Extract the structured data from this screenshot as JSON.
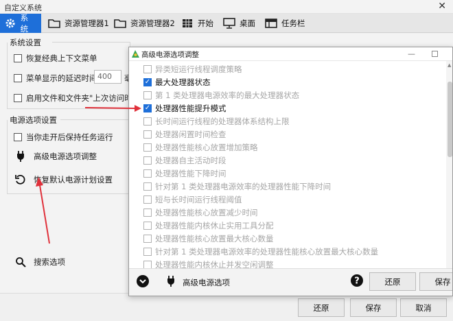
{
  "window": {
    "title": "自定义系统",
    "close_glyph": "✕"
  },
  "tabs": [
    {
      "label": "系统",
      "icon": "gear-icon",
      "active": true
    },
    {
      "label": "资源管理器1",
      "icon": "folder-icon"
    },
    {
      "label": "资源管理器2",
      "icon": "folder-icon"
    },
    {
      "label": "开始",
      "icon": "start-grid-icon"
    },
    {
      "label": "桌面",
      "icon": "monitor-icon"
    },
    {
      "label": "任务栏",
      "icon": "taskbar-icon"
    }
  ],
  "system_settings": {
    "title": "系统设置",
    "restore_classic_menu": "恢复经典上下文菜单",
    "menu_delay": {
      "label": "菜单显示的延迟时间",
      "value": "400",
      "unit": "毫"
    },
    "enable_recent_access": "启用文件和文件夹\"上次访问时间\""
  },
  "power_options": {
    "title": "电源选项设置",
    "keep_tasks": "当你走开后保持任务运行",
    "advanced_power": "高级电源选项调整",
    "restore_default_plan": "恢复默认电源计划设置"
  },
  "search": {
    "label": "搜索选项"
  },
  "footer": {
    "restore": "还原",
    "save": "保存",
    "cancel": "取消"
  },
  "dialog": {
    "title": "高级电源选项调整",
    "minimize_glyph": "—",
    "items": [
      {
        "label": "异类短运行线程调度策略",
        "checked": false
      },
      {
        "label": "最大处理器状态",
        "checked": true
      },
      {
        "label": "第 1 类处理器电源效率的最大处理器状态",
        "checked": false
      },
      {
        "label": "处理器性能提升模式",
        "checked": true
      },
      {
        "label": "长时间运行线程的处理器体系结构上限",
        "checked": false
      },
      {
        "label": "处理器闲置时间检查",
        "checked": false
      },
      {
        "label": "处理器性能核心放置增加策略",
        "checked": false
      },
      {
        "label": "处理器自主活动时段",
        "checked": false
      },
      {
        "label": "处理器性能下降时间",
        "checked": false
      },
      {
        "label": "针对第 1 类处理器电源效率的处理器性能下降时间",
        "checked": false
      },
      {
        "label": "短与长时间运行线程阈值",
        "checked": false
      },
      {
        "label": "处理器性能核心放置减少时间",
        "checked": false
      },
      {
        "label": "处理器性能内核休止实用工具分配",
        "checked": false
      },
      {
        "label": "处理器性能核心放置最大核心数量",
        "checked": false
      },
      {
        "label": "针对第 1 类处理器电源效率的处理器性能核心放置最大核心数量",
        "checked": false
      },
      {
        "label": "处理器性能内核休止并发空闲调整",
        "checked": false
      }
    ],
    "bottom_label": "高级电源选项",
    "restore": "还原",
    "save": "保存"
  },
  "colors": {
    "accent": "#1e6fd9",
    "arrow": "#e0303a"
  }
}
